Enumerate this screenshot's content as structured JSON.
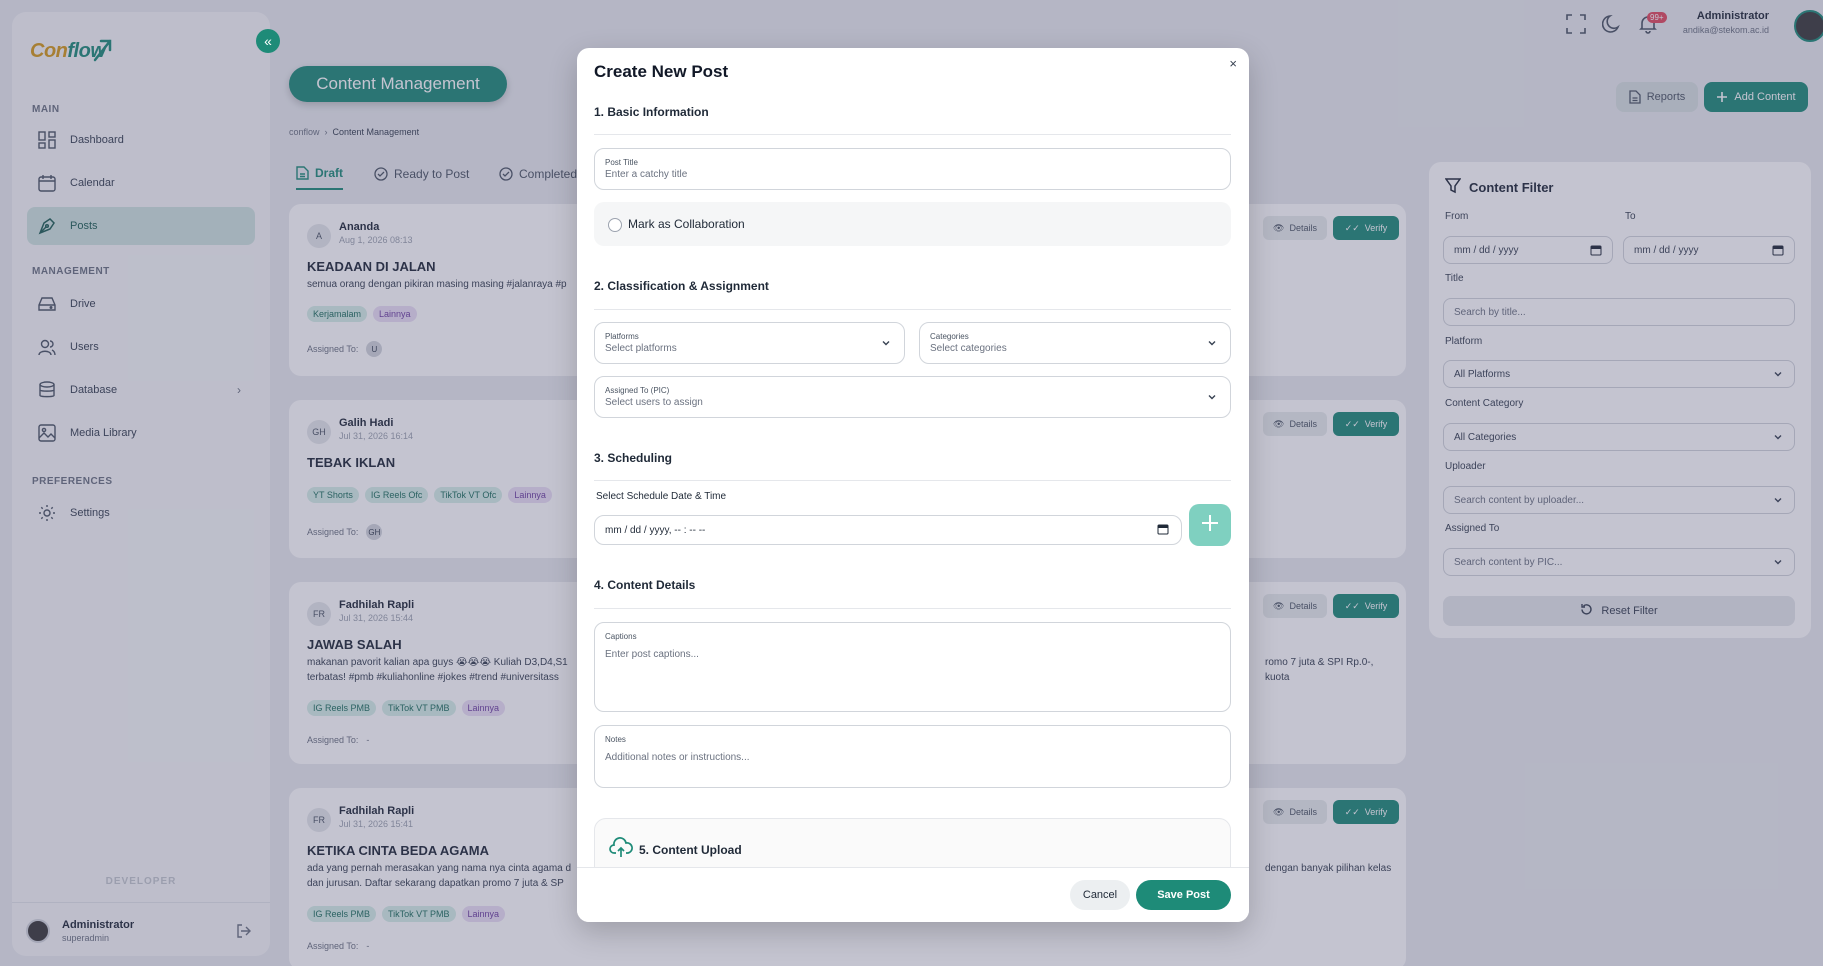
{
  "brand": {
    "logo_part1": "Con",
    "logo_part2": "flow"
  },
  "sidebar": {
    "sections": {
      "main": "MAIN",
      "management": "MANAGEMENT",
      "preferences": "PREFERENCES"
    },
    "items": [
      {
        "label": "Dashboard"
      },
      {
        "label": "Calendar"
      },
      {
        "label": "Posts"
      },
      {
        "label": "Drive"
      },
      {
        "label": "Users"
      },
      {
        "label": "Database"
      },
      {
        "label": "Media Library"
      },
      {
        "label": "Settings"
      }
    ],
    "developer_label": "DEVELOPER",
    "user": {
      "name": "Administrator",
      "role": "superadmin"
    }
  },
  "topbar": {
    "notification_count": "99+",
    "user_name": "Administrator",
    "user_email": "andika@stekom.ac.id"
  },
  "page": {
    "title": "Content Management",
    "breadcrumb": {
      "root": "conflow",
      "current": "Content Management"
    },
    "tabs": [
      {
        "label": "Draft"
      },
      {
        "label": "Ready to Post"
      },
      {
        "label": "Completed"
      }
    ],
    "reports_label": "Reports",
    "add_label": "Add Content"
  },
  "posts": [
    {
      "initials": "A",
      "author": "Ananda",
      "date": "Aug 1, 2026 08:13",
      "title": "KEADAAN DI JALAN",
      "caption": "semua orang dengan pikiran masing masing #jalanraya #p",
      "tags": [
        "Kerjamalam",
        "Lainnya"
      ],
      "assigned_label": "Assigned To:",
      "assigned": "U",
      "details": "Details",
      "verify": "Verify"
    },
    {
      "initials": "GH",
      "author": "Galih Hadi",
      "date": "Jul 31, 2026 16:14",
      "title": "TEBAK IKLAN",
      "caption": "",
      "tags": [
        "YT Shorts",
        "IG Reels Ofc",
        "TikTok VT Ofc",
        "Lainnya"
      ],
      "assigned_label": "Assigned To:",
      "assigned": "GH",
      "details": "Details",
      "verify": "Verify"
    },
    {
      "initials": "FR",
      "author": "Fadhilah Rapli",
      "date": "Jul 31, 2026 15:44",
      "title": "JAWAB SALAH",
      "caption": "makanan pavorit kalian apa guys 😭😭😭 Kuliah D3,D4,S1",
      "caption_right": "romo 7 juta & SPI Rp.0-, kuota",
      "caption2": "terbatas! #pmb #kuliahonline #jokes #trend #universitass",
      "tags": [
        "IG Reels PMB",
        "TikTok VT PMB",
        "Lainnya"
      ],
      "assigned_label": "Assigned To:",
      "assigned": "-",
      "details": "Details",
      "verify": "Verify"
    },
    {
      "initials": "FR",
      "author": "Fadhilah Rapli",
      "date": "Jul 31, 2026 15:41",
      "title": "KETIKA CINTA BEDA AGAMA",
      "caption": "ada yang pernah merasakan yang nama nya cinta agama d",
      "caption_right": "dengan banyak pilihan kelas",
      "caption2": "dan jurusan. Daftar sekarang dapatkan promo 7 juta & SP",
      "tags": [
        "IG Reels PMB",
        "TikTok VT PMB",
        "Lainnya"
      ],
      "assigned_label": "Assigned To:",
      "assigned": "-",
      "details": "Details",
      "verify": "Verify"
    }
  ],
  "filter": {
    "title": "Content Filter",
    "from_label": "From",
    "to_label": "To",
    "from_value": "mm / dd / yyyy",
    "to_value": "mm / dd / yyyy",
    "title_label": "Title",
    "title_placeholder": "Search by title...",
    "platform_label": "Platform",
    "platform_value": "All Platforms",
    "category_label": "Content Category",
    "category_value": "All Categories",
    "uploader_label": "Uploader",
    "uploader_placeholder": "Search content by uploader...",
    "assigned_label": "Assigned To",
    "assigned_placeholder": "Search content by PIC...",
    "reset_label": "Reset Filter"
  },
  "modal": {
    "title": "Create New Post",
    "close": "×",
    "sections": {
      "basic": "1. Basic Information",
      "classification": "2. Classification & Assignment",
      "scheduling": "3. Scheduling",
      "details": "4. Content Details",
      "upload": "5. Content Upload"
    },
    "post_title": {
      "label": "Post Title",
      "placeholder": "Enter a catchy title"
    },
    "collab_label": "Mark as Collaboration",
    "platforms": {
      "label": "Platforms",
      "placeholder": "Select platforms"
    },
    "categories": {
      "label": "Categories",
      "placeholder": "Select categories"
    },
    "assigned": {
      "label": "Assigned To (PIC)",
      "placeholder": "Select users to assign"
    },
    "schedule_label": "Select Schedule Date & Time",
    "schedule_value": "mm / dd / yyyy, -- : -- --",
    "captions": {
      "label": "Captions",
      "placeholder": "Enter post captions..."
    },
    "notes": {
      "label": "Notes",
      "placeholder": "Additional notes or instructions..."
    },
    "cancel_label": "Cancel",
    "save_label": "Save Post"
  },
  "colors": {
    "brand": "#1e8b78",
    "accent": "#d49a1a",
    "badge": "#e24b5f"
  }
}
